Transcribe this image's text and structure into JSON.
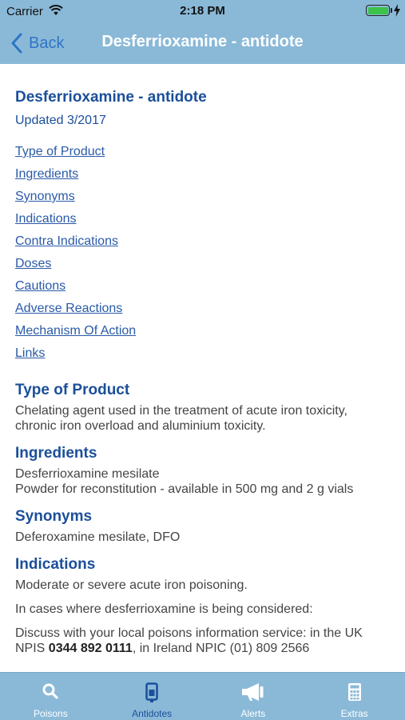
{
  "status_bar": {
    "carrier": "Carrier",
    "time": "2:18 PM"
  },
  "nav": {
    "back_label": "Back",
    "title": "Desferrioxamine - antidote"
  },
  "document": {
    "title": "Desferrioxamine - antidote",
    "updated": "Updated 3/2017",
    "toc": [
      "Type of Product",
      "Ingredients",
      "Synonyms",
      "Indications",
      "Contra Indications",
      "Doses",
      "Cautions",
      "Adverse Reactions",
      "Mechanism Of Action",
      "Links"
    ],
    "sections": {
      "type_of_product": {
        "heading": "Type of Product",
        "text": "Chelating agent used in the treatment of acute iron toxicity, chronic iron overload and aluminium toxicity."
      },
      "ingredients": {
        "heading": "Ingredients",
        "line1": "Desferrioxamine mesilate",
        "line2": "Powder for reconstitution - available in 500 mg and 2 g vials"
      },
      "synonyms": {
        "heading": "Synonyms",
        "text": "Deferoxamine mesilate, DFO"
      },
      "indications": {
        "heading": "Indications",
        "para1": "Moderate or severe acute iron poisoning.",
        "para2": "In cases where desferrioxamine is being considered:",
        "para3_start": "Discuss with your local poisons information service: in the UK NPIS ",
        "para3_phone_uk": "0344 892 0111",
        "para3_mid": ", in Ireland NPIC (01) 809 2566"
      }
    }
  },
  "tabs": [
    {
      "label": "Poisons",
      "icon": "search-icon",
      "active": false
    },
    {
      "label": "Antidotes",
      "icon": "antidote-vial-icon",
      "active": true
    },
    {
      "label": "Alerts",
      "icon": "megaphone-icon",
      "active": false
    },
    {
      "label": "Extras",
      "icon": "calculator-icon",
      "active": false
    }
  ],
  "colors": {
    "header_bg": "#8ab9d8",
    "heading_text": "#1b4f9a",
    "link_text": "#2a5aa8",
    "active_tab": "#1b4f9a"
  }
}
